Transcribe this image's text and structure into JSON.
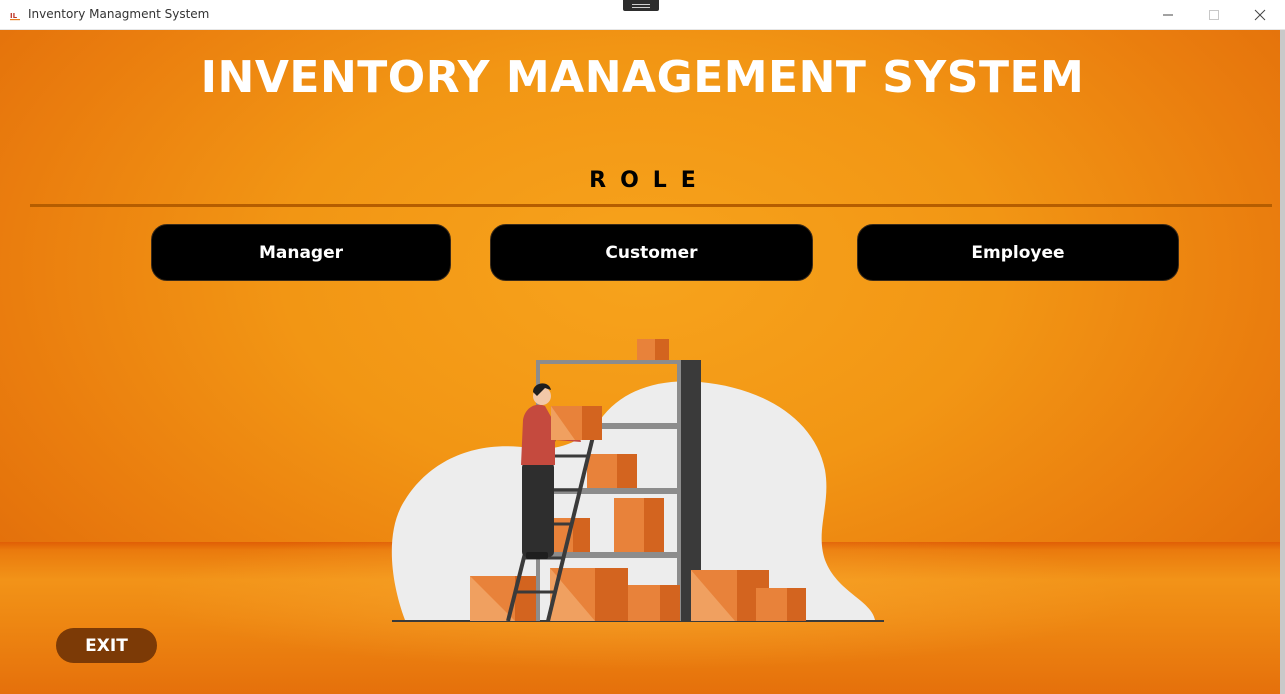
{
  "window": {
    "title": "Inventory Managment System",
    "icon": "app-icon"
  },
  "main": {
    "title": "INVENTORY MANAGEMENT SYSTEM",
    "role_heading": "ROLE",
    "roles": [
      {
        "label": "Manager"
      },
      {
        "label": "Customer"
      },
      {
        "label": "Employee"
      }
    ],
    "exit_label": "EXIT",
    "illustration": "warehouse-worker-on-ladder-illustration"
  },
  "colors": {
    "background": "#f29614",
    "role_button": "#000000",
    "exit_button": "#7c3a06",
    "divider": "#b55d00",
    "title_text": "#ffffff"
  }
}
